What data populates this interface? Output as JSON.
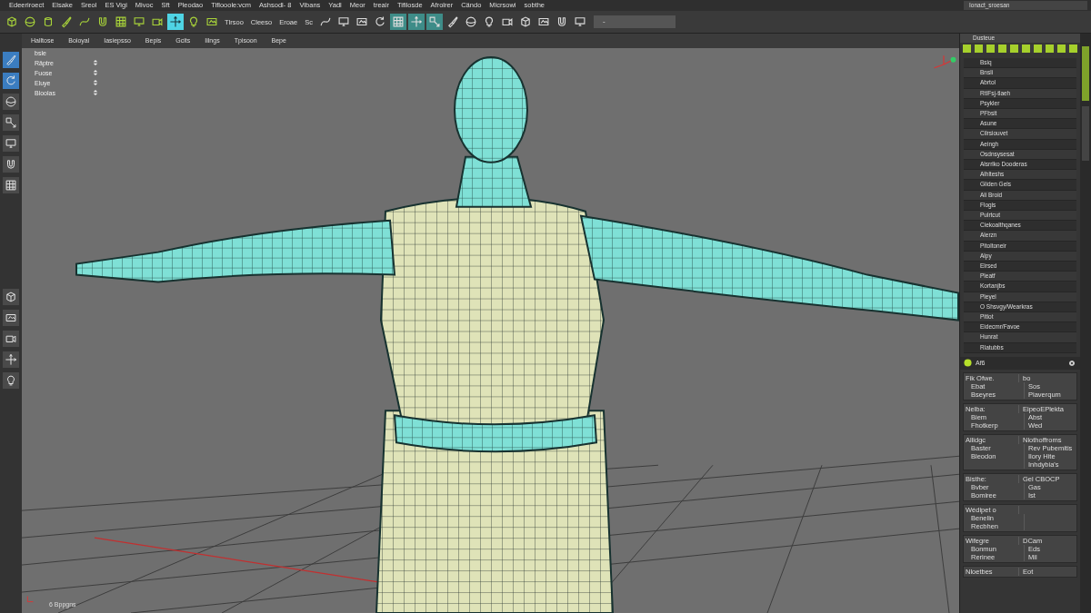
{
  "menu_bar": [
    "Edeeriroect",
    "Elsake",
    "Sreol",
    "ES Vigi",
    "Mivoc",
    "Sft",
    "Pleodao",
    "Tiflooole:vcm",
    "Ashsodl- 8",
    "Vibans",
    "Yadl",
    "Meor",
    "treair",
    "Tifilosde",
    "Afrolrer",
    "Cändo",
    "Micrsowi",
    "sobthe"
  ],
  "toolbar": {
    "tools_left": [
      {
        "kind": "cube",
        "selected": false
      },
      {
        "kind": "sphere",
        "selected": false
      },
      {
        "kind": "cylinder",
        "selected": false
      },
      {
        "kind": "brush",
        "selected": false
      },
      {
        "kind": "curve",
        "selected": false
      },
      {
        "kind": "magnet",
        "selected": false
      },
      {
        "kind": "grid",
        "selected": false
      },
      {
        "kind": "display",
        "selected": false
      },
      {
        "kind": "camera",
        "selected": false
      },
      {
        "kind": "move",
        "selected": true
      },
      {
        "kind": "light",
        "selected": false
      },
      {
        "kind": "render",
        "selected": false
      }
    ],
    "labels": [
      "Tlrsoo",
      "Cleeso",
      "Eroae",
      "Sc"
    ],
    "tools_right": [
      {
        "kind": "curve",
        "selected": false
      },
      {
        "kind": "display",
        "selected": false
      },
      {
        "kind": "render",
        "selected": false
      },
      {
        "kind": "rotate",
        "selected": false
      },
      {
        "kind": "grid",
        "selected": true
      },
      {
        "kind": "move",
        "selected": true
      },
      {
        "kind": "scale",
        "selected": true
      },
      {
        "kind": "brush",
        "selected": false
      },
      {
        "kind": "sphere",
        "selected": false
      },
      {
        "kind": "light",
        "selected": false
      },
      {
        "kind": "camera",
        "selected": false
      },
      {
        "kind": "cube",
        "selected": false
      },
      {
        "kind": "render",
        "selected": false
      },
      {
        "kind": "magnet",
        "selected": false
      },
      {
        "kind": "display",
        "selected": false
      }
    ],
    "field": {
      "value": "-"
    },
    "workspace": "Ionact_sroesan"
  },
  "tool_column": [
    {
      "kind": "brush",
      "selected": true
    },
    {
      "kind": "rotate",
      "selected": true
    },
    {
      "kind": "sphere",
      "selected": false
    },
    {
      "kind": "scale",
      "selected": false
    },
    {
      "kind": "display",
      "selected": false
    },
    {
      "kind": "magnet",
      "selected": false
    },
    {
      "kind": "grid",
      "selected": false
    },
    {
      "kind": "cube",
      "selected": false
    },
    {
      "kind": "render",
      "selected": false
    },
    {
      "kind": "camera",
      "selected": false
    },
    {
      "kind": "move",
      "selected": false
    },
    {
      "kind": "light",
      "selected": false
    }
  ],
  "viewport": {
    "menu": [
      "Halltose",
      "Boioyal",
      "Iasiepsso",
      "Bepis",
      "Gcits",
      "Iilngs",
      "Tpisoon",
      "Bepe"
    ],
    "overlay_title": "bsle",
    "overlay_rows": [
      "Räptre",
      "Fuose",
      "Eluye",
      "Bloolas"
    ],
    "status": "6 Bppgns"
  },
  "outliner": {
    "title": "Dusteue",
    "items": [
      "Bsiq",
      "Bnsli",
      "Abrtol",
      "RtIFsj-tlaeh",
      "Psykler",
      "PFbsit",
      "Asune",
      "Cilrsiouvet",
      "Aeingh",
      "Osdnsysesat",
      "Alsrrlko Dooderas",
      "Alhlteshs",
      "Gliden Gels",
      "Ali Broid",
      "Flogis",
      "Pulrtcut",
      "Ciekoalthqanes",
      "Alerzn",
      "Pitoltoneir",
      "Alpy",
      "Elrsed",
      "Pleatf",
      "Kortanjbs",
      "Pleyel",
      "O Shsvgy/Wearkras",
      "Pitlot",
      "Eidecmr/Favoe",
      "Hunrat",
      "Rlatubbs"
    ]
  },
  "attributes": {
    "title": "Af6",
    "groups": [
      {
        "title": "Fik Ofwe.",
        "value": "bo",
        "rows": [
          {
            "label": "Ebat",
            "value": "Sos"
          },
          {
            "label": "Bseyres",
            "value": "Piaverqum"
          }
        ]
      },
      {
        "title": "Nelba:",
        "value": "EipeoEPlekta",
        "rows": [
          {
            "label": "Biem",
            "value": "Abst"
          },
          {
            "label": "Fhotkerp",
            "value": "Wed"
          }
        ]
      },
      {
        "title": "Allidgc",
        "value": "Nlothoffroms",
        "rows": [
          {
            "label": "Baster",
            "value": "Rev Pubemitis"
          },
          {
            "label": "Bleodon",
            "value": "Ilory Hite"
          },
          {
            "value": "Inhdybia's"
          }
        ]
      },
      {
        "title": "Bisthe:",
        "value": "Gel CBOCP",
        "rows": [
          {
            "label": "Bvber",
            "value": "Gas"
          },
          {
            "label": "Bomiree",
            "value": "Ist"
          }
        ]
      },
      {
        "title": "Wédipet o",
        "rows": [
          {
            "label": "Benelin"
          },
          {
            "label": "Recbhen"
          }
        ]
      },
      {
        "title": "Wifegre",
        "value": "DCam",
        "rows": [
          {
            "label": "Bonmun",
            "value": "Eds"
          },
          {
            "label": "Rerinee",
            "value": "Mil"
          }
        ]
      },
      {
        "title": "Nloetbes",
        "value": "Eot"
      }
    ]
  }
}
